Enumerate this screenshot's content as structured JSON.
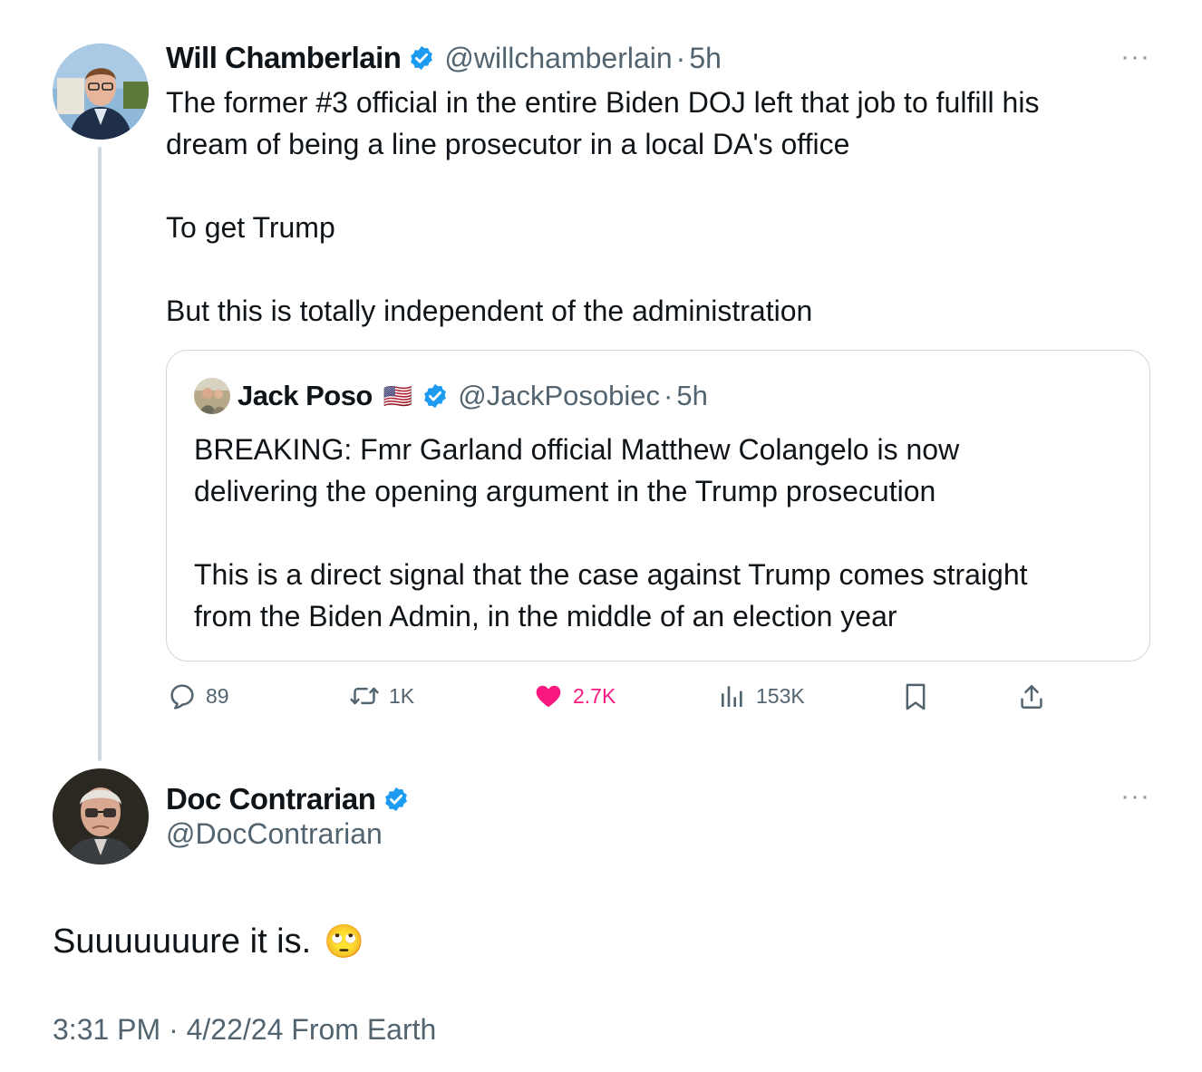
{
  "colors": {
    "verified": "#1d9bf0",
    "like": "#f91880",
    "muted": "#536471",
    "border": "#cfd9de"
  },
  "tweet1": {
    "author_name": "Will Chamberlain",
    "handle": "@willchamberlain",
    "dot": "·",
    "time": "5h",
    "text": "The former #3 official in the entire Biden DOJ left that job to fulfill his\ndream of being a line prosecutor in a local DA's office\n\nTo get Trump\n\nBut this is totally independent of the administration",
    "more": "···"
  },
  "quote": {
    "author_name": "Jack Poso",
    "flag": "🇺🇸",
    "handle": "@JackPosobiec",
    "dot": "·",
    "time": "5h",
    "text": "BREAKING: Fmr Garland official Matthew Colangelo is now\ndelivering the opening argument in the Trump prosecution\n\nThis is a direct signal that the case against Trump comes straight\nfrom the Biden Admin, in the middle of an election year"
  },
  "actions": {
    "replies": "89",
    "reposts": "1K",
    "likes": "2.7K",
    "views": "153K",
    "icons": [
      "reply-icon",
      "repost-icon",
      "heart-icon",
      "views-icon",
      "bookmark-icon",
      "share-icon"
    ]
  },
  "tweet2": {
    "author_name": "Doc Contrarian",
    "handle": "@DocContrarian",
    "text": "Suuuuuuure it is.",
    "emoji": "🙄",
    "timestamp": "3:31 PM · 4/22/24 From Earth",
    "more": "···"
  }
}
